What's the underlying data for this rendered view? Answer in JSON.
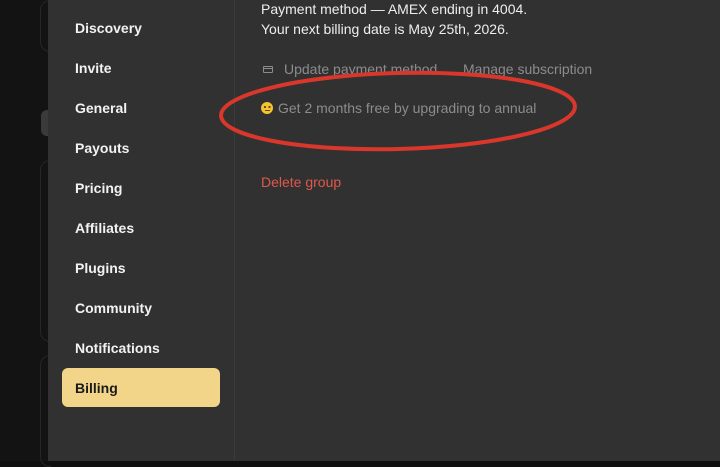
{
  "sidebar": {
    "items": [
      {
        "label": "Discovery"
      },
      {
        "label": "Invite"
      },
      {
        "label": "General"
      },
      {
        "label": "Payouts"
      },
      {
        "label": "Pricing"
      },
      {
        "label": "Affiliates"
      },
      {
        "label": "Plugins"
      },
      {
        "label": "Community"
      },
      {
        "label": "Notifications"
      },
      {
        "label": "Billing",
        "active": true
      }
    ]
  },
  "billing": {
    "payment_method": "Payment method — AMEX ending in 4004.",
    "next_billing": "Your next billing date is May 25th, 2026.",
    "update_payment_label": "Update payment method",
    "update_payment_icon": "credit-card-icon",
    "manage_subscription_label": "Manage subscription",
    "promo_icon": "smiley-emoji-icon",
    "promo_label": "Get 2 months free by upgrading to annual",
    "delete_group_label": "Delete group"
  },
  "colors": {
    "active_item_bg": "#f3d589",
    "panel_bg": "#313131",
    "danger": "#e0584b",
    "annotation": "#d9372b"
  }
}
